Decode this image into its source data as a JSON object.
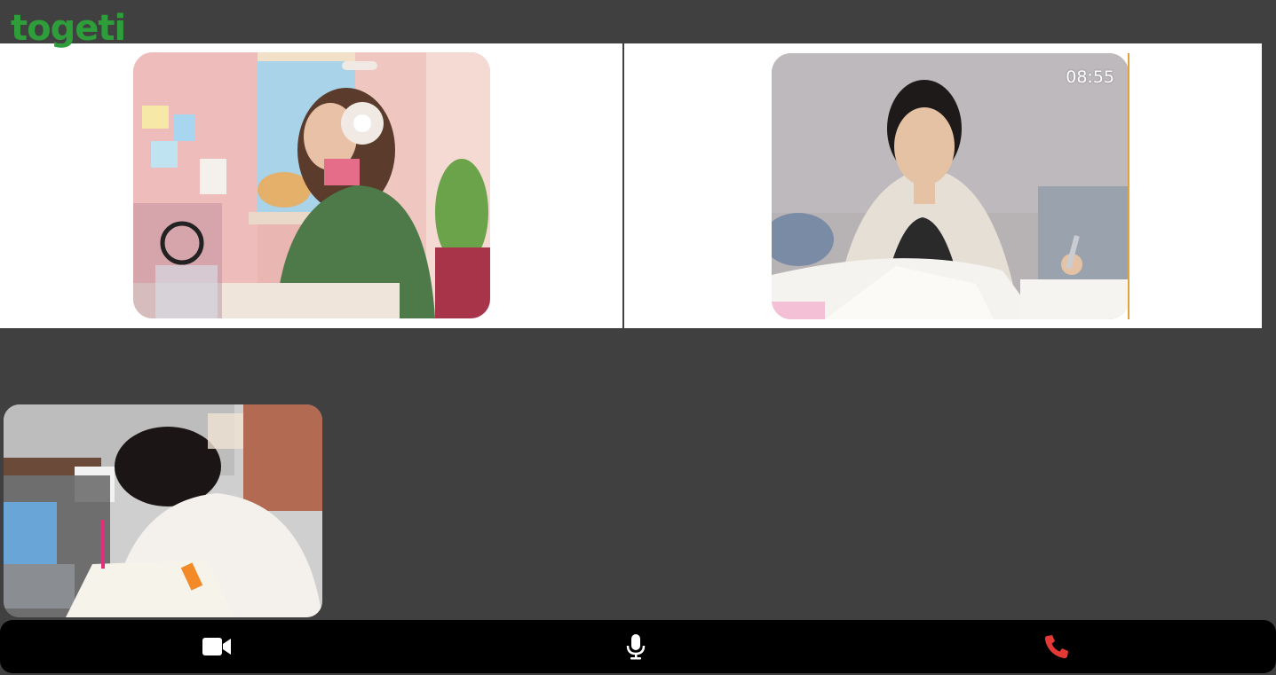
{
  "app": {
    "logo_text": "togeti",
    "brand_color": "#2e9e3a",
    "background_color": "#404040"
  },
  "participants": [
    {
      "id": "participant-1",
      "description_icon": "video-feed",
      "timer": ""
    },
    {
      "id": "participant-2",
      "description_icon": "video-feed",
      "timer": "08:55"
    },
    {
      "id": "participant-3-self",
      "description_icon": "video-feed",
      "timer": ""
    }
  ],
  "controls": {
    "camera": {
      "icon": "video-camera-icon",
      "color": "#ffffff"
    },
    "microphone": {
      "icon": "microphone-icon",
      "color": "#ffffff"
    },
    "hangup": {
      "icon": "phone-hangup-icon",
      "color": "#e53935"
    }
  }
}
